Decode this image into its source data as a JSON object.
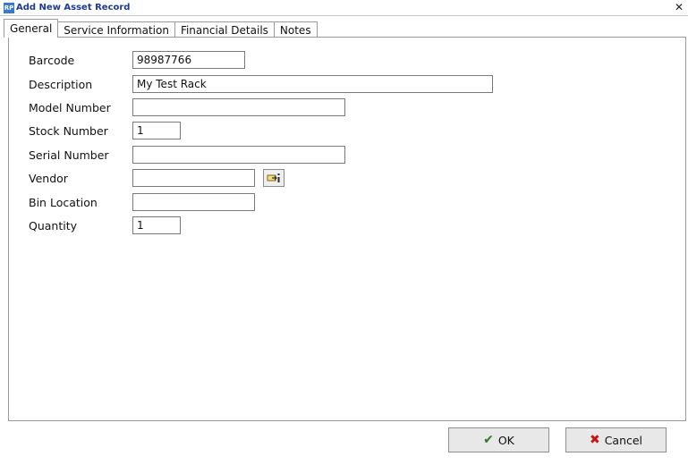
{
  "window": {
    "title": "Add New Asset Record",
    "icon_text": "RP",
    "close_glyph": "✕"
  },
  "tabs": [
    {
      "label": "General",
      "active": true
    },
    {
      "label": "Service Information",
      "active": false
    },
    {
      "label": "Financial Details",
      "active": false
    },
    {
      "label": "Notes",
      "active": false
    }
  ],
  "form": {
    "barcode": {
      "label": "Barcode",
      "value": "98987766"
    },
    "description": {
      "label": "Description",
      "value": "My Test Rack"
    },
    "model_number": {
      "label": "Model Number",
      "value": ""
    },
    "stock_number": {
      "label": "Stock Number",
      "value": "1"
    },
    "serial_number": {
      "label": "Serial Number",
      "value": ""
    },
    "vendor": {
      "label": "Vendor",
      "value": ""
    },
    "bin_location": {
      "label": "Bin Location",
      "value": ""
    },
    "quantity": {
      "label": "Quantity",
      "value": "1"
    }
  },
  "buttons": {
    "ok": {
      "label": "OK",
      "icon": "checkmark-icon"
    },
    "cancel": {
      "label": "Cancel",
      "icon": "x-icon"
    }
  },
  "colors": {
    "title_text": "#1f3a93",
    "ok_icon": "#2a7a1e",
    "cancel_icon": "#c61414"
  }
}
